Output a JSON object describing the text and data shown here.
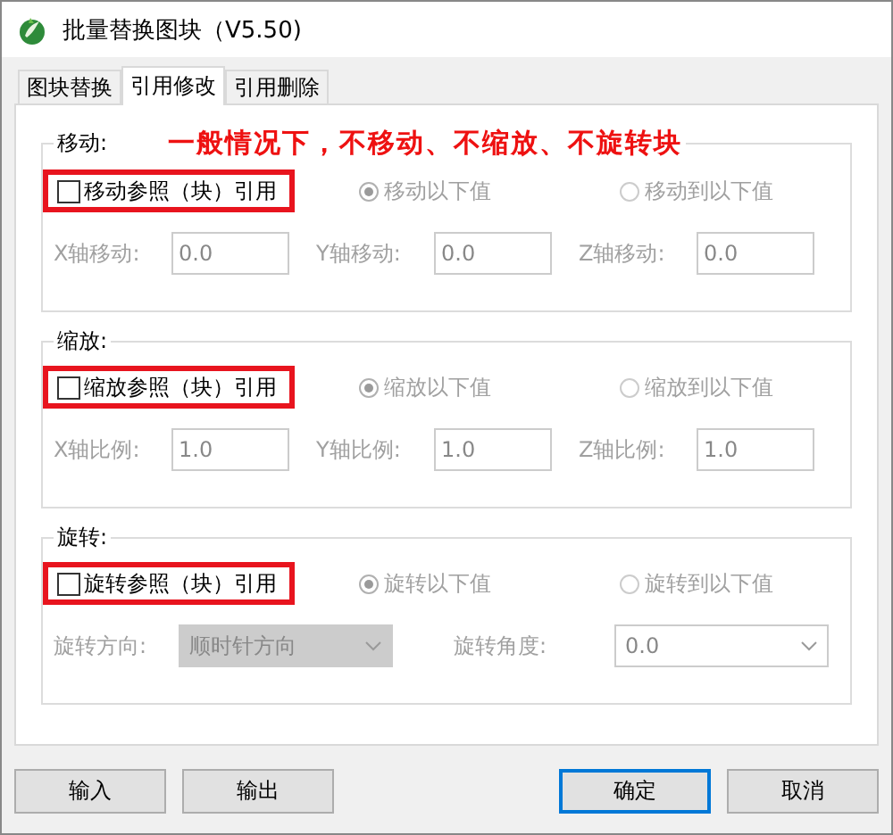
{
  "window": {
    "title": "批量替换图块（V5.50)"
  },
  "tabs": [
    {
      "label": "图块替换",
      "selected": false
    },
    {
      "label": "引用修改",
      "selected": true
    },
    {
      "label": "引用删除",
      "selected": false
    }
  ],
  "sections": [
    {
      "title": "移动:",
      "note": "一般情况下，不移动、不缩放、不旋转块",
      "checkbox": {
        "label": "移动参照（块）引用",
        "checked": false,
        "highlighted": true
      },
      "radios": [
        {
          "label": "移动以下值",
          "selected": true,
          "disabled": true
        },
        {
          "label": "移动到以下值",
          "selected": false,
          "disabled": true
        }
      ],
      "fields": [
        {
          "kind": "input",
          "label": "X轴移动:",
          "value": "0.0",
          "disabled": true
        },
        {
          "kind": "input",
          "label": "Y轴移动:",
          "value": "0.0",
          "disabled": true
        },
        {
          "kind": "input",
          "label": "Z轴移动:",
          "value": "0.0",
          "disabled": true
        }
      ]
    },
    {
      "title": "缩放:",
      "checkbox": {
        "label": "缩放参照（块）引用",
        "checked": false,
        "highlighted": true
      },
      "radios": [
        {
          "label": "缩放以下值",
          "selected": true,
          "disabled": true
        },
        {
          "label": "缩放到以下值",
          "selected": false,
          "disabled": true
        }
      ],
      "fields": [
        {
          "kind": "input",
          "label": "X轴比例:",
          "value": "1.0",
          "disabled": true
        },
        {
          "kind": "input",
          "label": "Y轴比例:",
          "value": "1.0",
          "disabled": true
        },
        {
          "kind": "input",
          "label": "Z轴比例:",
          "value": "1.0",
          "disabled": true
        }
      ]
    },
    {
      "title": "旋转:",
      "checkbox": {
        "label": "旋转参照（块）引用",
        "checked": false,
        "highlighted": true
      },
      "radios": [
        {
          "label": "旋转以下值",
          "selected": true,
          "disabled": true
        },
        {
          "label": "旋转到以下值",
          "selected": false,
          "disabled": true
        }
      ],
      "fields": [
        {
          "kind": "select",
          "label": "旋转方向:",
          "value": "顺时针方向",
          "disabled": true
        },
        {
          "kind": "combo",
          "label": "旋转角度:",
          "value": "0.0",
          "disabled": true
        }
      ]
    }
  ],
  "buttons": [
    {
      "label": "输入",
      "default": false
    },
    {
      "label": "输出",
      "default": false
    },
    {
      "label": "确定",
      "default": true
    },
    {
      "label": "取消",
      "default": false
    }
  ]
}
